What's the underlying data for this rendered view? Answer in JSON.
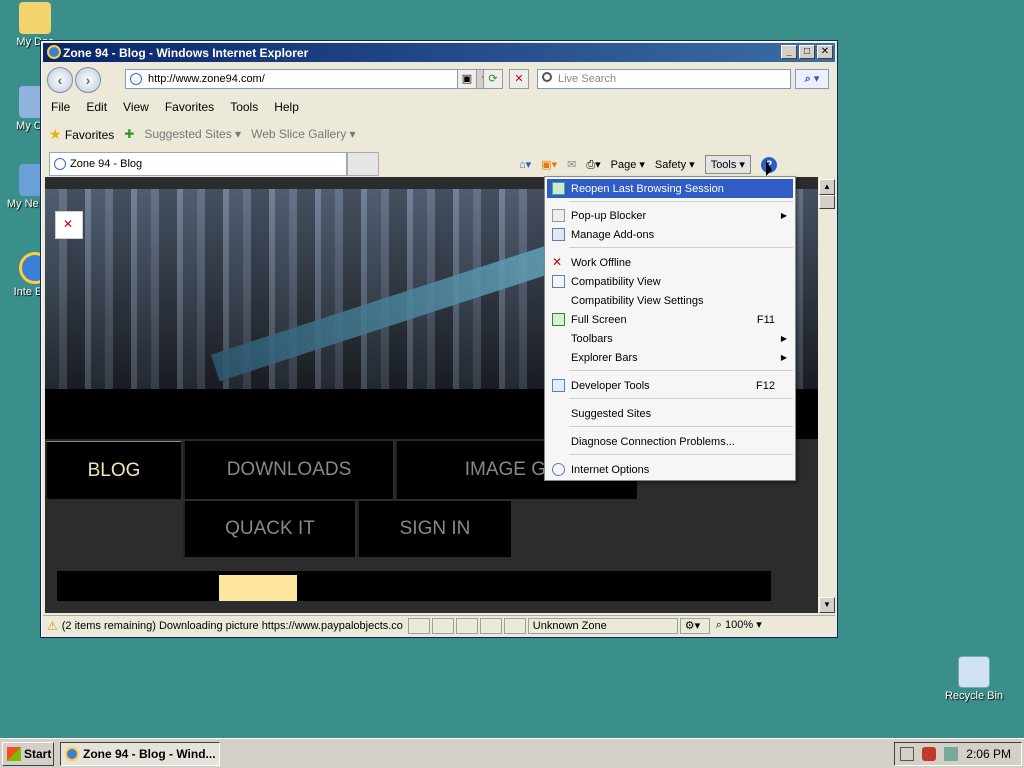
{
  "desktop": {
    "icons": [
      {
        "label": "My Doc"
      },
      {
        "label": "My Con"
      },
      {
        "label": "My Ne Plac"
      },
      {
        "label": "Inte Expl"
      },
      {
        "label": "Recycle Bin"
      }
    ]
  },
  "window": {
    "title": "Zone 94 - Blog - Windows Internet Explorer",
    "minimize": "_",
    "maximize": "□",
    "close": "✕"
  },
  "address": {
    "url": "http://www.zone94.com/",
    "search_placeholder": "Live Search"
  },
  "menubar": [
    "File",
    "Edit",
    "View",
    "Favorites",
    "Tools",
    "Help"
  ],
  "favorites_bar": {
    "favorites": "Favorites",
    "suggested_sites": "Suggested Sites ▾",
    "web_slice_gallery": "Web Slice Gallery ▾"
  },
  "tab": {
    "title": "Zone 94 - Blog"
  },
  "commandbar": {
    "page": "Page ▾",
    "safety": "Safety ▾",
    "tools": "Tools ▾",
    "help": "?"
  },
  "site_nav": {
    "blog": "BLOG",
    "downloads": "DOWNLOADS",
    "image_gallery": "IMAGE GAL",
    "quack_it": "QUACK IT",
    "sign_in": "SIGN IN"
  },
  "status": {
    "message": "(2 items remaining) Downloading picture https://www.paypalobjects.co",
    "zone": "Unknown Zone",
    "zoom": "100%"
  },
  "tools_menu": {
    "reopen": "Reopen Last Browsing Session",
    "popup_blocker": "Pop-up Blocker",
    "manage_addons": "Manage Add-ons",
    "work_offline": "Work Offline",
    "compat_view": "Compatibility View",
    "compat_settings": "Compatibility View Settings",
    "full_screen": "Full Screen",
    "full_screen_key": "F11",
    "toolbars": "Toolbars",
    "explorer_bars": "Explorer Bars",
    "dev_tools": "Developer Tools",
    "dev_tools_key": "F12",
    "suggested_sites": "Suggested Sites",
    "diagnose": "Diagnose Connection Problems...",
    "internet_options": "Internet Options"
  },
  "taskbar": {
    "start": "Start",
    "task": "Zone 94 - Blog - Wind...",
    "clock": "2:06 PM"
  },
  "colors": {
    "desktop": "#3a8f8a",
    "highlight": "#2f5cc5",
    "active_nav": "#f2e6b6"
  }
}
